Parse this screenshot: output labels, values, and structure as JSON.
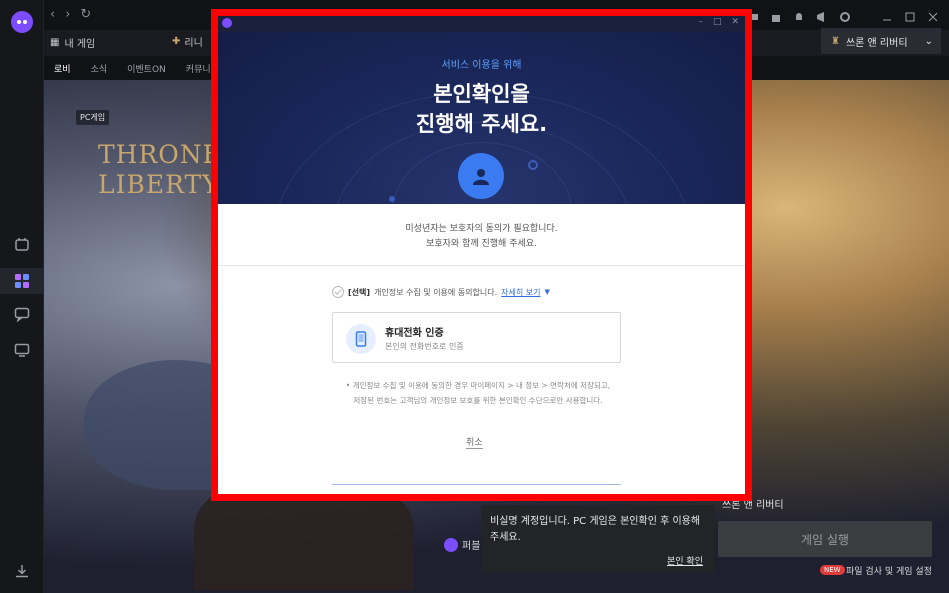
{
  "topbar": {
    "game_tab_mygames": "내 게임",
    "game_tab_lineage": "리니",
    "active_game": "쓰론 앤 리버티"
  },
  "subnav": {
    "items": [
      "로비",
      "소식",
      "이벤트ON",
      "커뮤니"
    ]
  },
  "background": {
    "badge": "PC게임",
    "logo_text_line1": "THRONE",
    "logo_text_line2": "LIBERTY",
    "right_title": "쓰론 앤 리버티",
    "play_button": "게임 실행",
    "new_badge": "NEW",
    "file_check": "파일 검사 및 게임 설정",
    "profile_label": "퍼블"
  },
  "toast": {
    "message": "비실명 계정입니다. PC 게임은 본인확인 후 이용해 주세요.",
    "link": "본인 확인"
  },
  "modal": {
    "subtitle": "서비스 이용을 위해",
    "title_line1": "본인확인을",
    "title_line2": "진행해 주세요.",
    "notice_line1": "미성년자는 보호자의 동의가 필요합니다.",
    "notice_line2": "보호자와 함께 진행해 주세요.",
    "consent_tag": "[선택]",
    "consent_text": "개인정보 수집 및 이용에 동의합니다.",
    "consent_detail": "자세히 보기",
    "phone_title": "휴대전화 인증",
    "phone_sub": "본인의 전화번호로 인증",
    "info_line1": "• 개인정보 수집 및 이용에 동의한 경우 마이페이지 > 내 정보 > 연락처에 저장되고,",
    "info_line2": "저장된 번호는 고객님의 개인정보 보호를 위한 본인확인 수단으로만 사용합니다.",
    "cancel": "취소"
  },
  "colors": {
    "highlight": "#ff0000",
    "accent_blue": "#3a7bf2",
    "hero_navy": "#1a275a",
    "purple": "#7b4dff"
  }
}
